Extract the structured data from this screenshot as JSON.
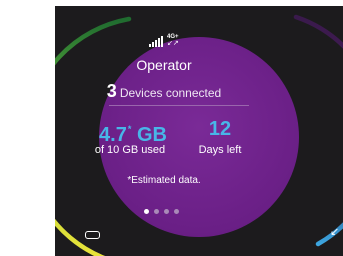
{
  "status": {
    "network_type": "4G+",
    "network_arrows": "↙↗",
    "signal_icon": "signal-bars-icon"
  },
  "operator": {
    "name": "Operator"
  },
  "devices": {
    "count": "3",
    "label": "Devices connected"
  },
  "data_usage": {
    "value": "4.7",
    "marker": "*",
    "unit": "GB",
    "caption": "of 10 GB used",
    "used_gb": 4.7,
    "total_gb": 10
  },
  "days": {
    "value": "12",
    "caption": "Days left"
  },
  "note": "*Estimated data.",
  "pager": {
    "total": 4,
    "active_index": 0
  },
  "colors": {
    "disc": "#6a1f86",
    "accent_blue": "#48b6e8",
    "ring_green": "#8dc63f",
    "ring_yellow": "#e1e23a",
    "ring_purple": "#4a1d5e",
    "background": "#1c1b1d"
  },
  "icons": {
    "battery": "battery-icon",
    "corner": "arrow-down-left-icon"
  }
}
